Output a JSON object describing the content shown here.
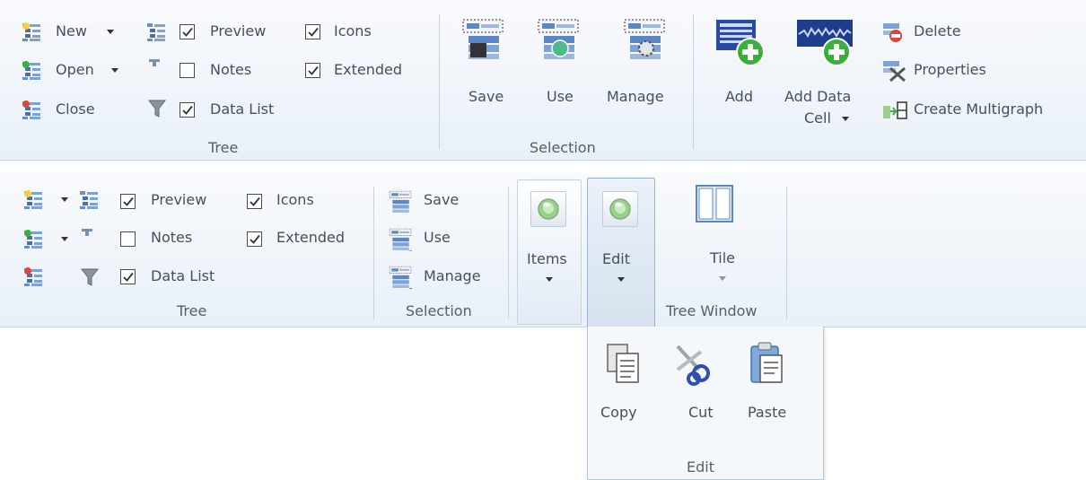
{
  "ribbon1": {
    "tree": {
      "new": "New",
      "open": "Open",
      "close": "Close",
      "preview": "Preview",
      "notes": "Notes",
      "data_list": "Data List",
      "icons": "Icons",
      "extended": "Extended",
      "group": "Tree",
      "preview_checked": true,
      "notes_checked": false,
      "data_list_checked": true,
      "icons_checked": true,
      "extended_checked": true
    },
    "selection": {
      "save": "Save",
      "use": "Use",
      "manage": "Manage",
      "group": "Selection"
    },
    "data": {
      "add": "Add",
      "add_data_1": "Add Data",
      "add_data_2": "Cell",
      "delete": "Delete",
      "properties": "Properties",
      "create_multigraph": "Create Multigraph"
    }
  },
  "ribbon2": {
    "tree": {
      "preview": "Preview",
      "notes": "Notes",
      "data_list": "Data List",
      "icons": "Icons",
      "extended": "Extended",
      "group": "Tree"
    },
    "selection": {
      "save": "Save",
      "use": "Use",
      "manage": "Manage",
      "group": "Selection"
    },
    "items": "Items",
    "edit": "Edit",
    "tile": "Tile",
    "tree_window_group": "Tree Window"
  },
  "popup": {
    "copy": "Copy",
    "cut": "Cut",
    "paste": "Paste",
    "group": "Edit"
  },
  "colors": {
    "ribbon_bg": "#e9f0f8",
    "border": "#c3d0df",
    "text": "#45505c",
    "accent_green": "#3cae3c"
  }
}
